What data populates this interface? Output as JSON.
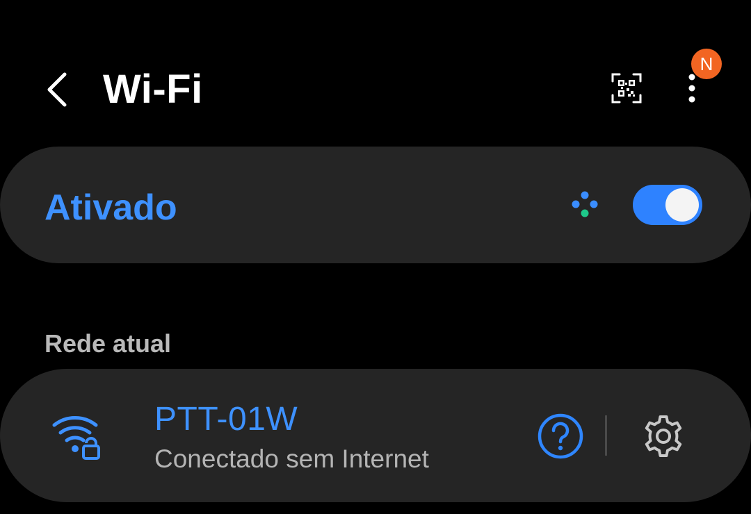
{
  "header": {
    "title": "Wi-Fi",
    "back_icon": "chevron-left-icon",
    "qr_icon": "qr-code-icon",
    "more_icon": "more-vertical-icon",
    "notification_badge": "N"
  },
  "master_switch": {
    "label": "Ativado",
    "enabled": true,
    "scanning_icon": "scanning-dots-icon"
  },
  "current_network_section": {
    "header": "Rede atual",
    "network": {
      "name": "PTT-01W",
      "status": "Conectado sem Internet",
      "signal_icon": "wifi-lock-icon",
      "help_icon": "question-circle-icon",
      "settings_icon": "gear-icon"
    }
  },
  "colors": {
    "accent": "#3e91ff",
    "toggle_track": "#2e82ff",
    "badge": "#f26522",
    "background": "#000000",
    "card": "#252525",
    "scan_dot_blue": "#3a8dff",
    "scan_dot_green": "#1ec98a"
  }
}
